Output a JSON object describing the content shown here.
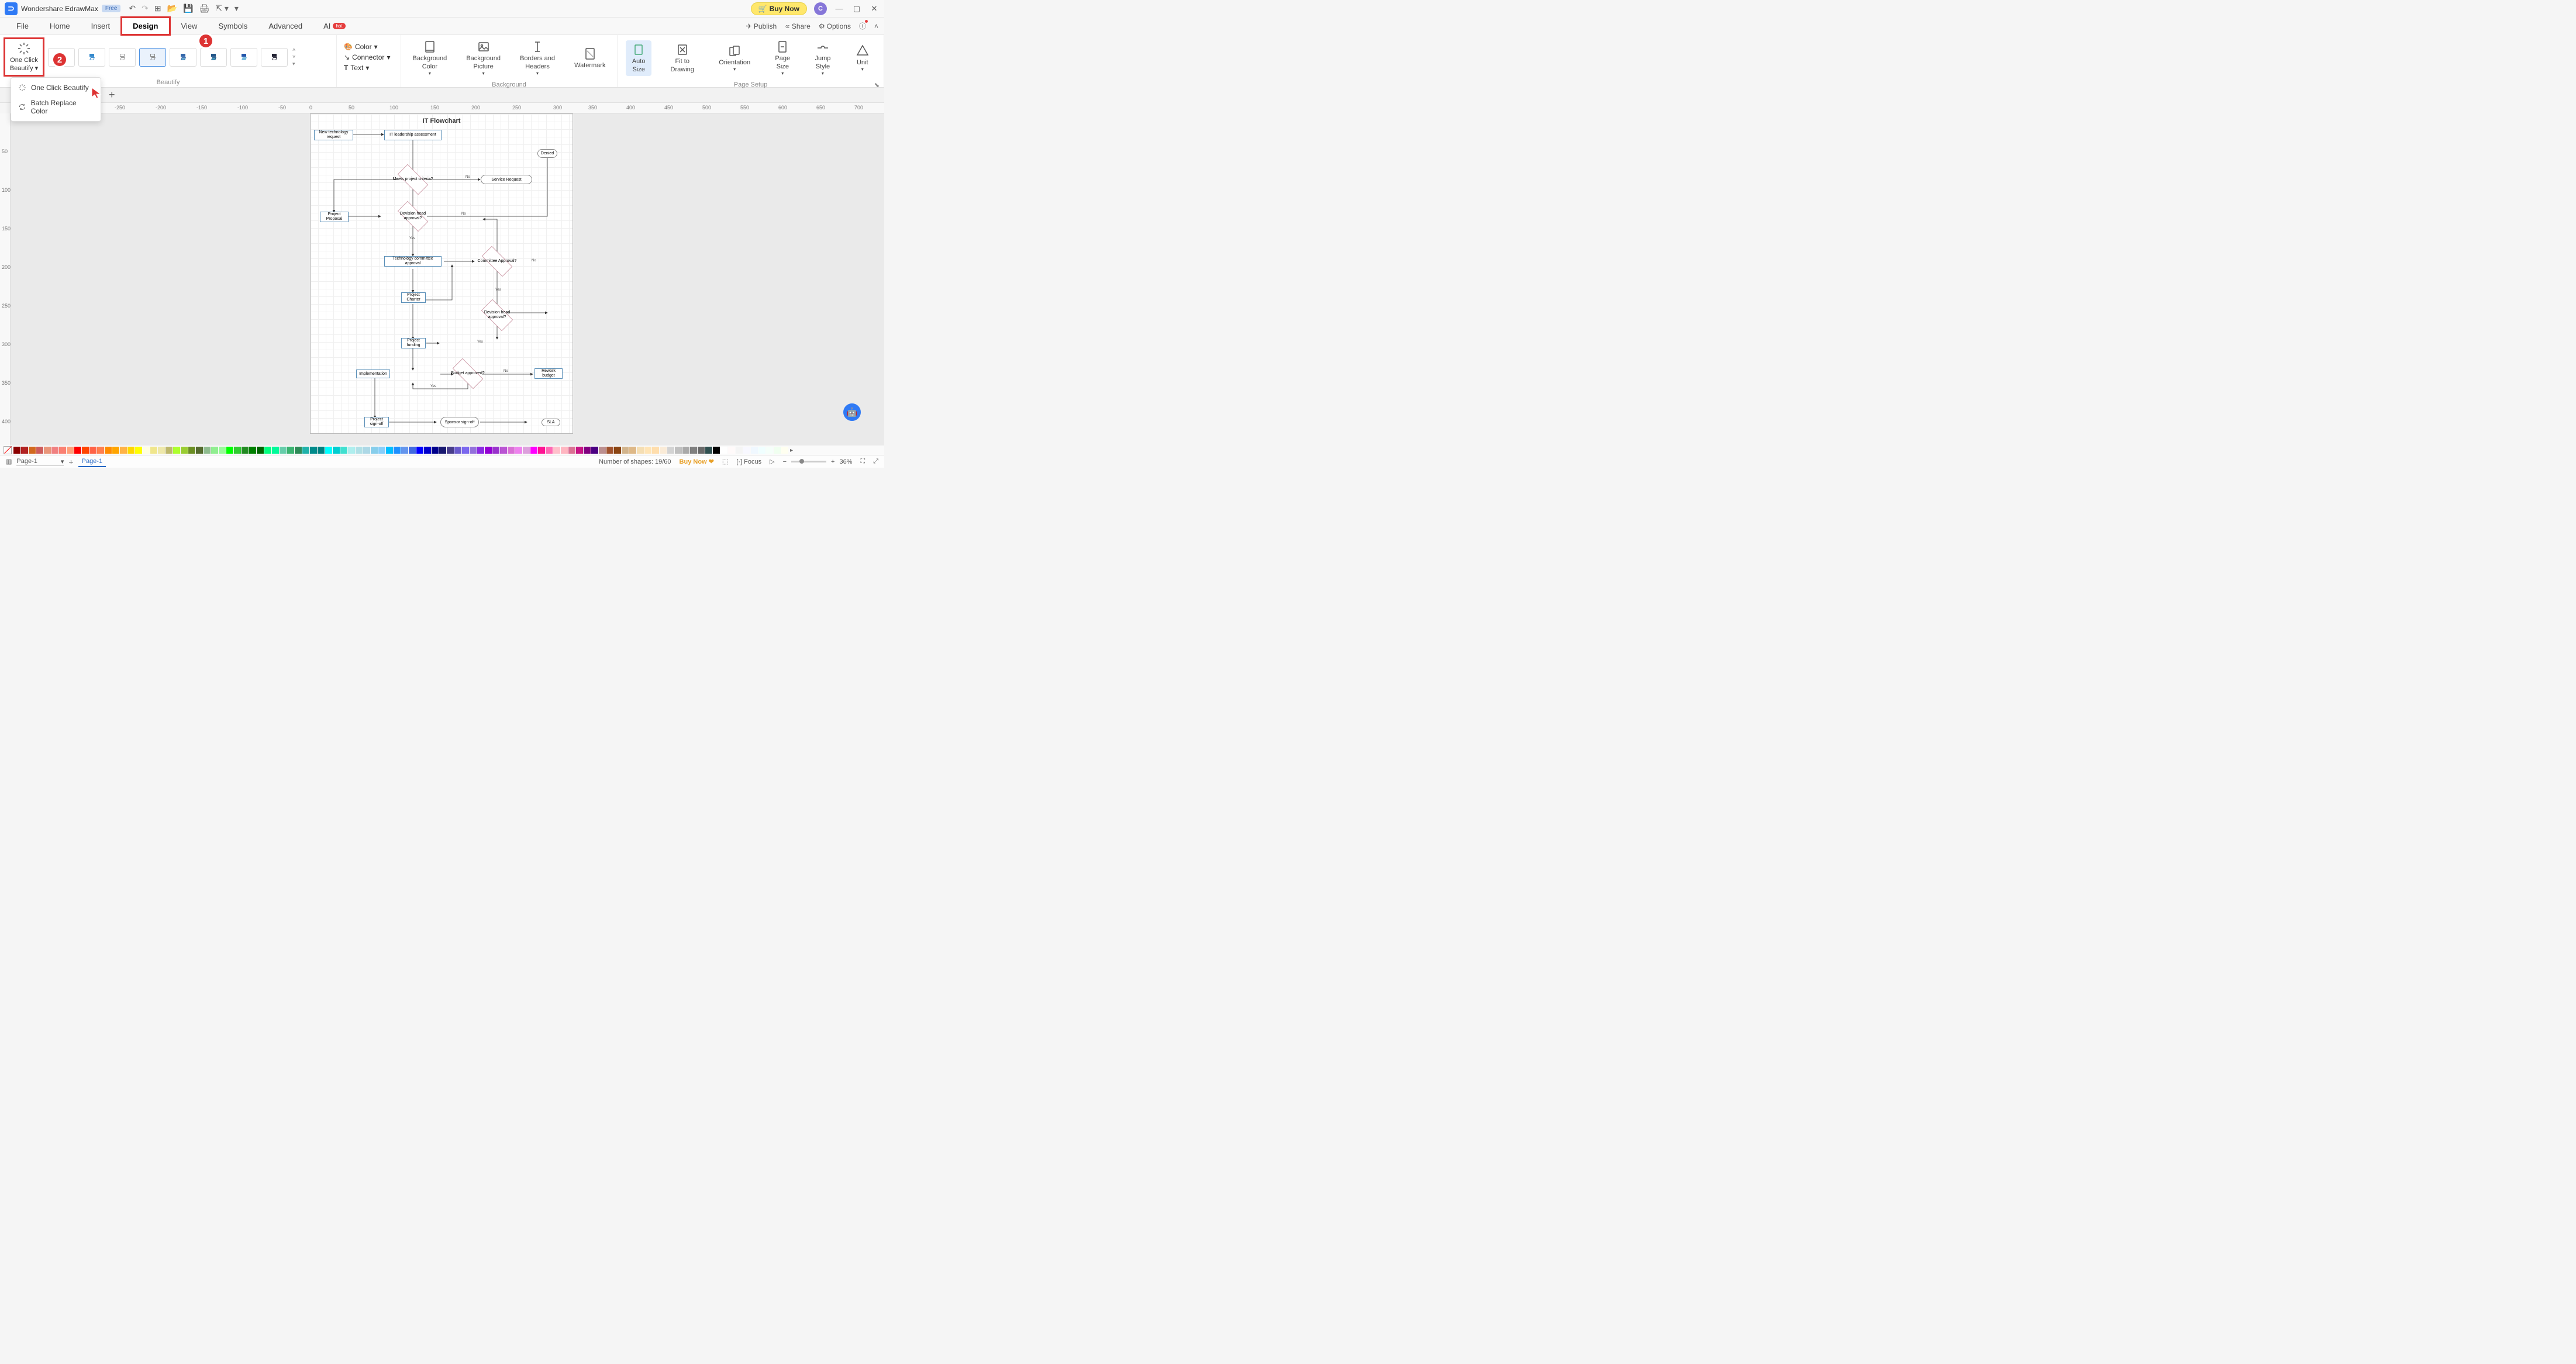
{
  "app": {
    "title": "Wondershare EdrawMax",
    "free_badge": "Free"
  },
  "titlebar_right": {
    "buy_now": "Buy Now",
    "avatar_letter": "C"
  },
  "menu_tabs": [
    "File",
    "Home",
    "Insert",
    "Design",
    "View",
    "Symbols",
    "Advanced"
  ],
  "ai_tab": {
    "label": "AI",
    "badge": "hot"
  },
  "menu_right": {
    "publish": "Publish",
    "share": "Share",
    "options": "Options"
  },
  "ribbon": {
    "oneclick": {
      "line1": "One Click",
      "line2": "Beautify"
    },
    "beautify_label": "Beautify",
    "color": "Color",
    "connector": "Connector",
    "text": "Text",
    "bg_color": {
      "l1": "Background",
      "l2": "Color"
    },
    "bg_pic": {
      "l1": "Background",
      "l2": "Picture"
    },
    "borders": {
      "l1": "Borders and",
      "l2": "Headers"
    },
    "watermark": "Watermark",
    "bg_group": "Background",
    "autosize": {
      "l1": "Auto",
      "l2": "Size"
    },
    "fit": {
      "l1": "Fit to",
      "l2": "Drawing"
    },
    "orientation": "Orientation",
    "pagesize": {
      "l1": "Page",
      "l2": "Size"
    },
    "jump": {
      "l1": "Jump",
      "l2": "Style"
    },
    "unit": "Unit",
    "pagesetup_group": "Page Setup"
  },
  "callouts": {
    "c1": "1",
    "c2": "2"
  },
  "dropdown": {
    "item1": "One Click Beautify",
    "item2": "Batch Replace Color"
  },
  "ruler_h": {
    "m250": "-250",
    "m200": "-200",
    "m150": "-150",
    "m100": "-100",
    "m50": "-50",
    "p0": "0",
    "p50": "50",
    "p100": "100",
    "p150": "150",
    "p200": "200",
    "p250": "250",
    "p300": "300",
    "p350": "350",
    "p400": "400",
    "p450": "450",
    "p500": "500",
    "p550": "550",
    "p600": "600",
    "p650": "650",
    "p700": "700"
  },
  "ruler_v": {
    "p50": "50",
    "p100": "100",
    "p150": "150",
    "p200": "200",
    "p250": "250",
    "p300": "300",
    "p350": "350",
    "p400": "400"
  },
  "flowchart": {
    "title": "IT Flowchart",
    "new_tech": "New technology request",
    "leadership": "IT leadership assessment",
    "denied": "Denied",
    "criteria": "Meets project criteria?",
    "service_req": "Service Request",
    "proposal": "Project Proposal",
    "dev_head": "Devision head approval?",
    "tech_comm": "Technology committee approval",
    "comm_appr": "Committee Approval?",
    "charter": "Project Charter",
    "dev_head2": "Devision head approval?",
    "funding": "Project funding",
    "budget": "Budget approved?",
    "impl": "Implementation",
    "rework": "Rework budget",
    "signoff": "Project sign-off",
    "sponsor": "Sponsor sign-off",
    "sla": "SLA",
    "yes": "Yes",
    "no": "No"
  },
  "status": {
    "page_dd": "Page-1",
    "page_tab": "Page-1",
    "shapes": "Number of shapes: 19/60",
    "buy_now": "Buy Now",
    "focus": "Focus",
    "zoom": "36%"
  },
  "colors": [
    "#8b0000",
    "#b22222",
    "#d2691e",
    "#cd5c5c",
    "#e9967a",
    "#f08080",
    "#fa8072",
    "#ffa07a",
    "#ff0000",
    "#ff4500",
    "#ff6347",
    "#ff7f50",
    "#ff8c00",
    "#ffa500",
    "#ffb347",
    "#ffd700",
    "#ffff00",
    "#ffffe0",
    "#f0e68c",
    "#eee8aa",
    "#bdb76b",
    "#adff2f",
    "#9acd32",
    "#6b8e23",
    "#556b2f",
    "#8fbc8f",
    "#90ee90",
    "#98fb98",
    "#00ff00",
    "#32cd32",
    "#228b22",
    "#008000",
    "#006400",
    "#00ff7f",
    "#00fa9a",
    "#66cdaa",
    "#3cb371",
    "#2e8b57",
    "#20b2aa",
    "#008b8b",
    "#008080",
    "#00ffff",
    "#00ced1",
    "#40e0d0",
    "#afeeee",
    "#b0e0e6",
    "#add8e6",
    "#87ceeb",
    "#87cefa",
    "#00bfff",
    "#1e90ff",
    "#6495ed",
    "#4169e1",
    "#0000ff",
    "#0000cd",
    "#00008b",
    "#191970",
    "#483d8b",
    "#6a5acd",
    "#7b68ee",
    "#9370db",
    "#8a2be2",
    "#9400d3",
    "#9932cc",
    "#ba55d3",
    "#da70d6",
    "#ee82ee",
    "#dda0dd",
    "#ff00ff",
    "#ff1493",
    "#ff69b4",
    "#ffc0cb",
    "#ffb6c1",
    "#db7093",
    "#c71585",
    "#800080",
    "#4b0082",
    "#bc8f8f",
    "#a0522d",
    "#8b4513",
    "#d2b48c",
    "#deb887",
    "#f5deb3",
    "#ffe4b5",
    "#ffdead",
    "#faebd7",
    "#d3d3d3",
    "#c0c0c0",
    "#a9a9a9",
    "#808080",
    "#696969",
    "#2f4f4f",
    "#000000",
    "#ffffff",
    "#fffafa",
    "#f5f5f5",
    "#f8f8ff",
    "#f0f8ff",
    "#f0ffff",
    "#f5fffa",
    "#f0fff0",
    "#fffff0"
  ]
}
